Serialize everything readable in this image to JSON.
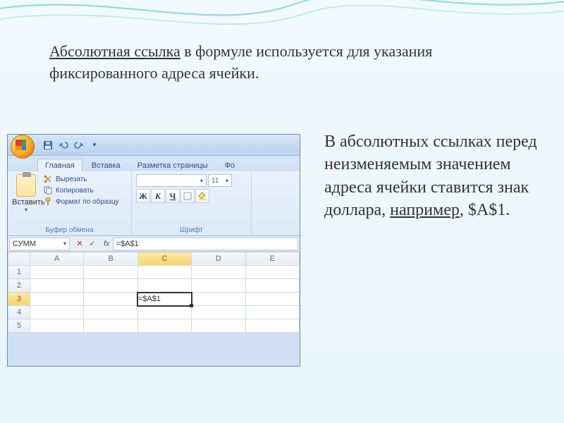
{
  "heading": {
    "term": "Абсолютная ссылка",
    "rest": " в формуле используется для указания фиксированного адреса ячейки."
  },
  "side": {
    "l1": "В абсолютных ссылках перед неизменяемым значением адреса ячейки ставится знак доллара, ",
    "eg": "например",
    "l2": ", $A$1."
  },
  "excel": {
    "tabs": {
      "home": "Главная",
      "insert": "Вставка",
      "layout": "Разметка страницы",
      "formulas": "Фо"
    },
    "paste": "Вставить",
    "clipboard": {
      "cut": "Вырезать",
      "copy": "Копировать",
      "brush": "Формат по образцу",
      "group": "Буфер обмена"
    },
    "font": {
      "name": "",
      "size": "11",
      "group": "Шрифт",
      "bold": "Ж",
      "italic": "К",
      "underline": "Ч"
    },
    "namebox": "СУММ",
    "formula": "=$A$1",
    "cell_display": "=$A$1",
    "cols": [
      "A",
      "B",
      "C",
      "D",
      "E"
    ],
    "rows": [
      "1",
      "2",
      "3",
      "4",
      "5"
    ]
  }
}
